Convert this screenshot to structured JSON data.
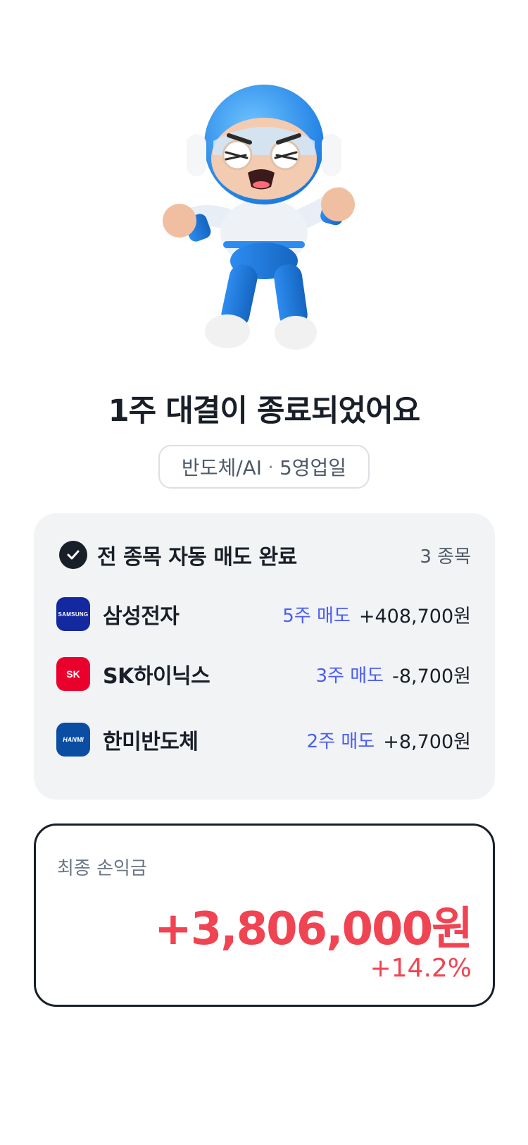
{
  "header": {
    "title": "1주 대결이 종료되었어요",
    "tag_category": "반도체/AI",
    "tag_separator": "·",
    "tag_duration": "5영업일"
  },
  "summary": {
    "check_icon": "check-circle-icon",
    "title": "전 종목 자동 매도 완료",
    "count": "3 종목",
    "stocks": [
      {
        "name": "삼성전자",
        "logo_text": "SAMSUNG",
        "logo_color": "#1428a0",
        "shares": "5주 매도",
        "pnl": "+408,700원"
      },
      {
        "name": "SK하이닉스",
        "logo_text": "SK",
        "logo_color": "#ea002c",
        "shares": "3주 매도",
        "pnl": "-8,700원"
      },
      {
        "name": "한미반도체",
        "logo_text": "HANMI",
        "logo_color": "#0a4da3",
        "shares": "2주 매도",
        "pnl": "+8,700원"
      }
    ]
  },
  "result": {
    "label": "최종 손익금",
    "amount": "+3,806,000원",
    "rate": "+14.2%"
  },
  "colors": {
    "accent_blue": "#4a5cf5",
    "profit_red": "#f04452",
    "text_dark": "#191f28"
  }
}
